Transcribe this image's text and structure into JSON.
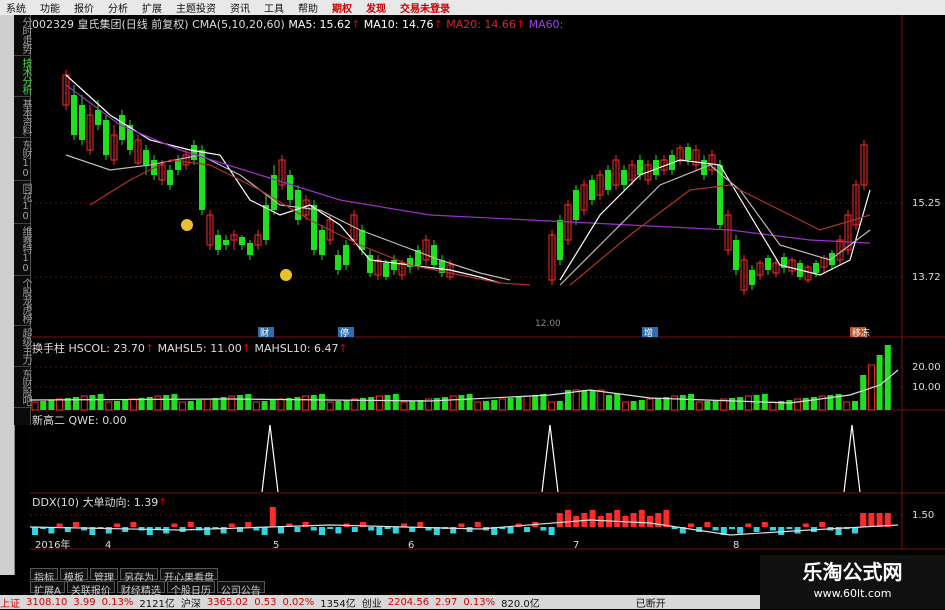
{
  "menu": [
    "系统",
    "功能",
    "报价",
    "分析",
    "扩展",
    "主题投资",
    "资讯",
    "工具",
    "帮助",
    "期权",
    "发现",
    "交易未登录"
  ],
  "sidebar_tabs": [
    {
      "label": "分时走势",
      "active": false
    },
    {
      "label": "技术分析",
      "active": true
    },
    {
      "label": "基本资料",
      "active": false
    },
    {
      "label": "东财10",
      "active": false
    },
    {
      "label": "同花10",
      "active": false
    },
    {
      "label": "维赛特10",
      "active": false
    },
    {
      "label": "个股龙虎榜",
      "active": false
    },
    {
      "label": "超级主力",
      "active": false
    },
    {
      "label": "东财股吧",
      "active": false
    }
  ],
  "main_header": {
    "code_name": "002329 皇氏集团(日线 前复权)",
    "cma": "CMA(5,10,20,60)",
    "ma5": "MA5: 15.62",
    "ma10": "MA10: 14.76",
    "ma20": "MA20: 14.66",
    "ma60": "MA60:"
  },
  "price_axis": [
    "15.25",
    "13.72"
  ],
  "price_markers": [
    "财",
    "停",
    "增",
    "移冻"
  ],
  "low_label": "12.00",
  "vol_header": {
    "a": "换手柱",
    "b": "HSCOL: 23.70",
    "c": "MAHSL5: 11.00",
    "d": "MAHSL10: 6.47"
  },
  "vol_axis": [
    "20.00",
    "10.00"
  ],
  "ind_header": {
    "a": "新高二",
    "b": "QWE: 0.00"
  },
  "ddx_header": {
    "a": "DDX(10)",
    "b": "大单动向: 1.39"
  },
  "ddx_axis": [
    "1.50"
  ],
  "dates": [
    "2016年",
    "4",
    "5",
    "6",
    "7",
    "8"
  ],
  "bottom_tabs": [
    "指标",
    "模板",
    "管理",
    "另存为",
    "开心果看盘"
  ],
  "bottom_tabs2": [
    "扩展A",
    "关联报价",
    "财经精选",
    "个股日历",
    "公司公告"
  ],
  "status": {
    "sh_label": "上证",
    "sh_val": "3108.10",
    "sh_chg": "3.99",
    "sh_pct": "0.13%",
    "sh_amt": "2121亿",
    "hs_label": "沪深",
    "hs_val": "3365.02",
    "hs_chg": "0.53",
    "hs_pct": "0.02%",
    "hs_amt": "1354亿",
    "cy_label": "创业",
    "cy_val": "2204.56",
    "cy_chg": "2.97",
    "cy_pct": "0.13%",
    "cy_amt": "820.0亿",
    "conn": "已断开"
  },
  "watermark": {
    "title": "乐淘公式网",
    "url": "www.60lt.com"
  },
  "colors": {
    "up": "#ff2a2a",
    "down": "#1fe01f",
    "ma5": "#ffffff",
    "ma20": "#b03030",
    "ma60": "#9b30c8",
    "ddx_down": "#30d5e0"
  }
}
